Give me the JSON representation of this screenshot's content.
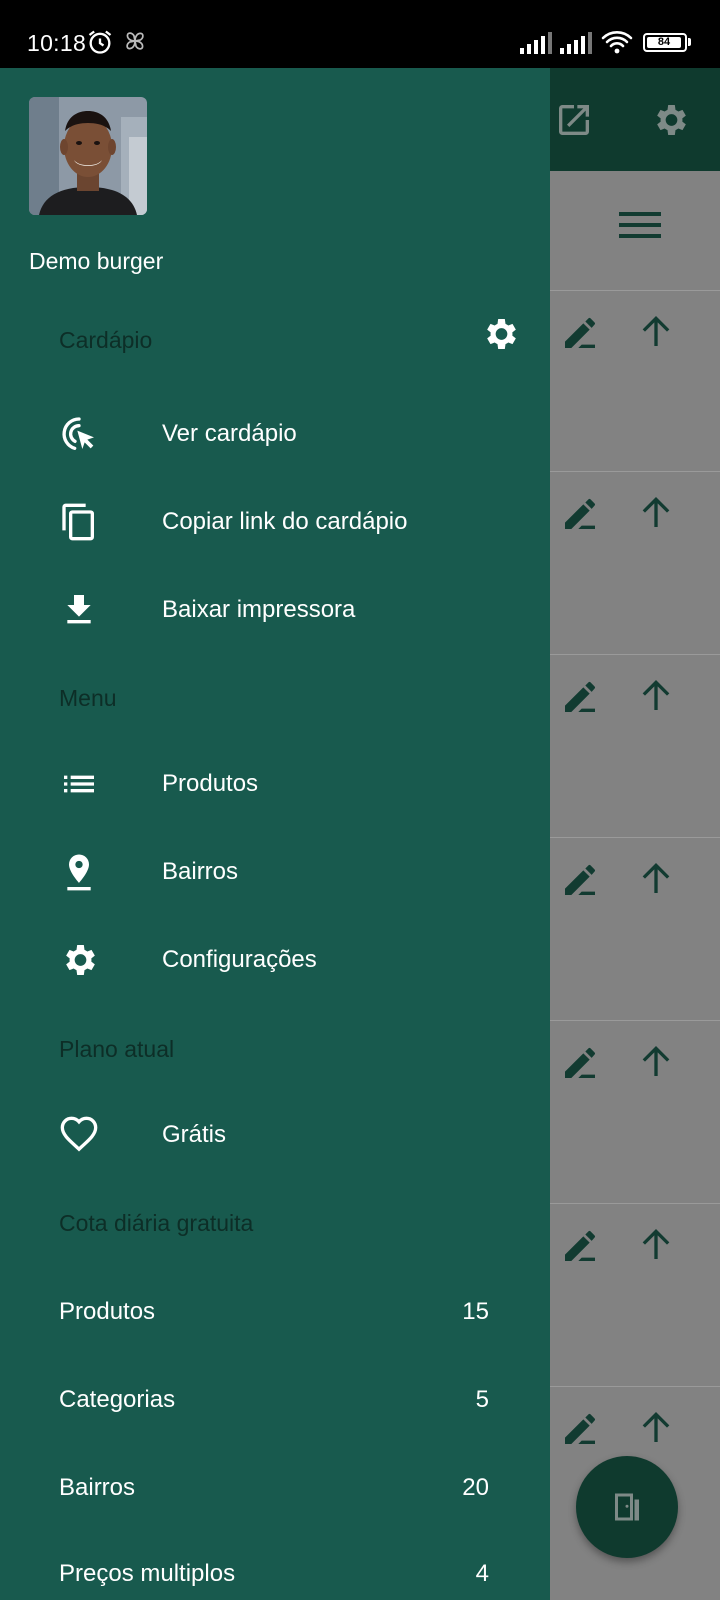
{
  "status_bar": {
    "time": "10:18",
    "battery": "84",
    "icons": [
      "alarm-icon",
      "pinwheel-icon",
      "signal-icon",
      "signal-icon",
      "wifi-icon",
      "battery-icon"
    ]
  },
  "drawer": {
    "user_name": "Demo burger",
    "sections": {
      "menu_card": {
        "title": "Cardápio",
        "settings_icon": "gear-icon",
        "items": [
          {
            "label": "Ver cardápio",
            "icon": "touch-cursor-icon"
          },
          {
            "label": "Copiar link do cardápio",
            "icon": "copy-icon"
          },
          {
            "label": "Baixar impressora",
            "icon": "download-icon"
          }
        ]
      },
      "menu": {
        "title": "Menu",
        "items": [
          {
            "label": "Produtos",
            "icon": "list-icon"
          },
          {
            "label": "Bairros",
            "icon": "location-pin-icon"
          },
          {
            "label": "Configurações",
            "icon": "gear-icon"
          }
        ]
      },
      "plan": {
        "title": "Plano atual",
        "items": [
          {
            "label": "Grátis",
            "icon": "heart-icon"
          }
        ]
      },
      "quota": {
        "title": "Cota diária gratuita",
        "rows": [
          {
            "label": "Produtos",
            "value": "15"
          },
          {
            "label": "Categorias",
            "value": "5"
          },
          {
            "label": "Bairros",
            "value": "20"
          },
          {
            "label": "Preços multiplos",
            "value": "4"
          }
        ]
      }
    }
  },
  "background_app": {
    "appbar_icons": [
      "open-external-icon",
      "gear-icon"
    ],
    "row_icons": [
      "edit-icon",
      "arrow-up-icon"
    ],
    "fab_icon": "exit-door-icon"
  },
  "colors": {
    "drawer_bg": "#185a4e",
    "appbar_bg": "#0f3a2e",
    "section_title": "#0d2e27",
    "scrim": "#7f7f7f"
  }
}
